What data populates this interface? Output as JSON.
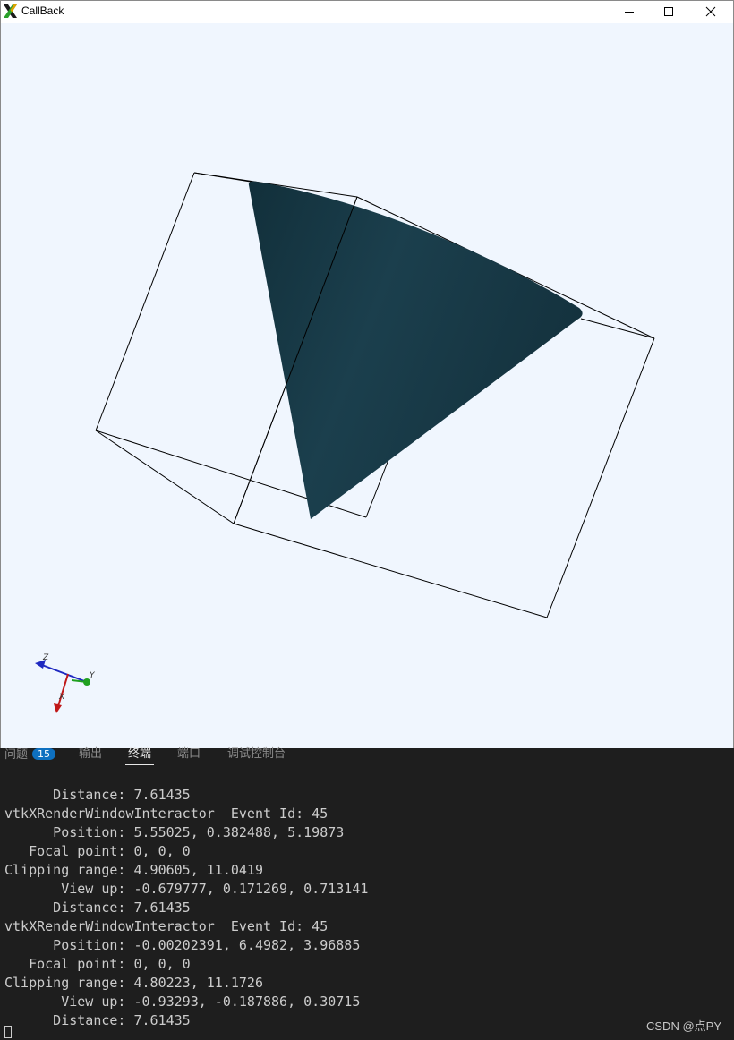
{
  "window": {
    "title": "CallBack"
  },
  "viewport": {
    "actor_color": "#163a46",
    "background_color": "#f0f6fe",
    "axes": {
      "x_label": "X",
      "y_label": "Y",
      "z_label": "Z",
      "x_color": "#c01818",
      "y_color": "#20a020",
      "z_color": "#1e28c0"
    }
  },
  "panel": {
    "tabs": [
      {
        "label": "问题",
        "badge": "15"
      },
      {
        "label": "输出"
      },
      {
        "label": "终端",
        "active": true
      },
      {
        "label": "端口"
      },
      {
        "label": "调试控制台"
      }
    ],
    "terminal_lines": [
      "      Distance: 7.61435",
      "vtkXRenderWindowInteractor  Event Id: 45",
      "      Position: 5.55025, 0.382488, 5.19873",
      "   Focal point: 0, 0, 0",
      "Clipping range: 4.90605, 11.0419",
      "       View up: -0.679777, 0.171269, 0.713141",
      "      Distance: 7.61435",
      "vtkXRenderWindowInteractor  Event Id: 45",
      "      Position: -0.00202391, 6.4982, 3.96885",
      "   Focal point: 0, 0, 0",
      "Clipping range: 4.80223, 11.1726",
      "       View up: -0.93293, -0.187886, 0.30715",
      "      Distance: 7.61435"
    ],
    "watermark": "CSDN @点PY"
  }
}
